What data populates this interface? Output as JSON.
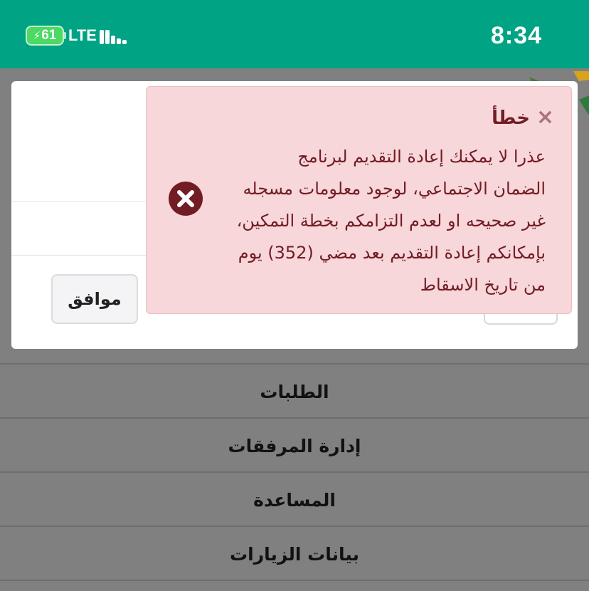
{
  "status_bar": {
    "battery_level": "61",
    "network": "LTE",
    "time": "8:34",
    "background_color": "#00a383"
  },
  "menu": {
    "items": [
      {
        "label": "الطلبات"
      },
      {
        "label": "إدارة المرفقات"
      },
      {
        "label": "المساعدة"
      },
      {
        "label": "بيانات الزيارات"
      }
    ]
  },
  "dialog": {
    "ok_label": "موافق"
  },
  "alert": {
    "title": "خطأ",
    "close_glyph": "×",
    "message": "عذرا لا يمكنك إعادة التقديم لبرنامج\nالضمان الاجتماعي، لوجود معلومات مسجله\nغير صحيحه او لعدم التزامكم بخطة التمكين،\nبإمكانكم إعادة التقديم بعد مضي (352) يوم\nمن تاريخ الاسقاط",
    "icon": "error-circle-x-icon",
    "accent_color": "#721c24",
    "background_color": "#f7d7da"
  }
}
